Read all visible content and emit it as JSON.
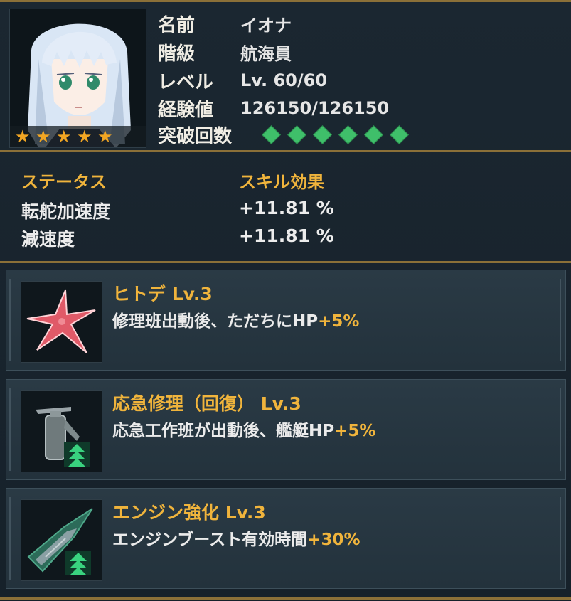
{
  "profile": {
    "name_label": "名前",
    "name_value": "イオナ",
    "rank_label": "階級",
    "rank_value": "航海員",
    "level_label": "レベル",
    "level_value": "Lv. 60/60",
    "exp_label": "経験値",
    "exp_value": "126150/126150",
    "breakthrough_label": "突破回数",
    "breakthrough_count": 6,
    "star_rating": 5,
    "star_glyph": "★"
  },
  "status": {
    "header_left": "ステータス",
    "header_right": "スキル効果",
    "rows": [
      {
        "label": "転舵加速度",
        "value": "+11.81 %"
      },
      {
        "label": "減速度",
        "value": "+11.81 %"
      }
    ]
  },
  "skills": [
    {
      "name": "ヒトデ Lv.3",
      "desc": "修理班出動後、ただちにHP",
      "bonus": "+5%",
      "icon": "starfish-icon"
    },
    {
      "name": "応急修理（回復） Lv.3",
      "desc": "応急工作班が出動後、艦艇HP",
      "bonus": "+5%",
      "icon": "fire-extinguisher-icon"
    },
    {
      "name": "エンジン強化 Lv.3",
      "desc": "エンジンブースト有効時間",
      "bonus": "+30%",
      "icon": "ship-boost-icon"
    }
  ],
  "colors": {
    "accent_gold": "#f0b43c",
    "divider": "#8b7038",
    "diamond_green": "#3fbf6a",
    "star": "#f2a623"
  }
}
